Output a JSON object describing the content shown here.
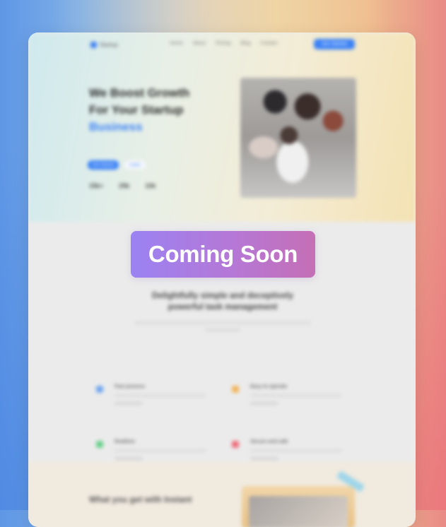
{
  "overlay": {
    "label": "Coming Soon"
  },
  "nav": {
    "logo_text": "Startup",
    "links": [
      "Home",
      "About",
      "Pricing",
      "Blog",
      "Contact"
    ],
    "cta_label": "Get Started"
  },
  "hero": {
    "title_line1": "We Boost Growth",
    "title_line2": "For Your Startup",
    "title_accent": "Business",
    "lead": "",
    "primary_button": "Get Started",
    "secondary_button": "Learn",
    "stats": [
      {
        "value": "15k+",
        "label": ""
      },
      {
        "value": "25k",
        "label": ""
      },
      {
        "value": "10k",
        "label": ""
      }
    ]
  },
  "features": {
    "title": "Delightfully simple and deceptively powerful task management",
    "cards": [
      {
        "title": "Fast process"
      },
      {
        "title": "Easy to operate"
      },
      {
        "title": "Realtime"
      },
      {
        "title": "Secure and safe"
      }
    ]
  },
  "bottom": {
    "title": "What you get with Instant"
  },
  "colors": {
    "accent": "#3b82f6",
    "overlay_start": "#9b82f2",
    "overlay_end": "#c56fb5",
    "feature_blue": "#6ea5ee",
    "feature_orange": "#f2b45a",
    "feature_green": "#66cf8a",
    "feature_red": "#ee6b7a"
  }
}
